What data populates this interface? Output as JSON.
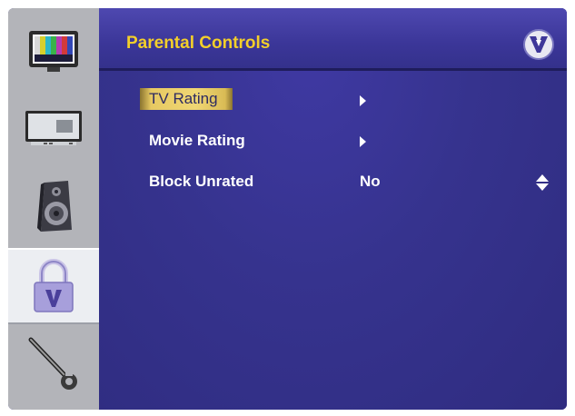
{
  "header": {
    "title": "Parental Controls",
    "logo_icon": "vizio-v-logo-icon"
  },
  "sidebar": {
    "items": [
      {
        "icon": "picture-color-bars-icon",
        "selected": false
      },
      {
        "icon": "tv-input-icon",
        "selected": false
      },
      {
        "icon": "speaker-audio-icon",
        "selected": false
      },
      {
        "icon": "padlock-parental-icon",
        "selected": true
      },
      {
        "icon": "wrench-setup-icon",
        "selected": false
      }
    ]
  },
  "menu": {
    "items": [
      {
        "label": "TV Rating",
        "highlighted": true,
        "control": "submenu-arrow-icon"
      },
      {
        "label": "Movie Rating",
        "highlighted": false,
        "control": "submenu-arrow-icon"
      },
      {
        "label": "Block Unrated",
        "value": "No",
        "highlighted": false,
        "control": "up-down-arrows-icon"
      }
    ]
  },
  "colors": {
    "background": "#3a3593",
    "title": "#f3cf2a",
    "highlight": "#f0d774",
    "sidebar": "#b3b4b9"
  }
}
